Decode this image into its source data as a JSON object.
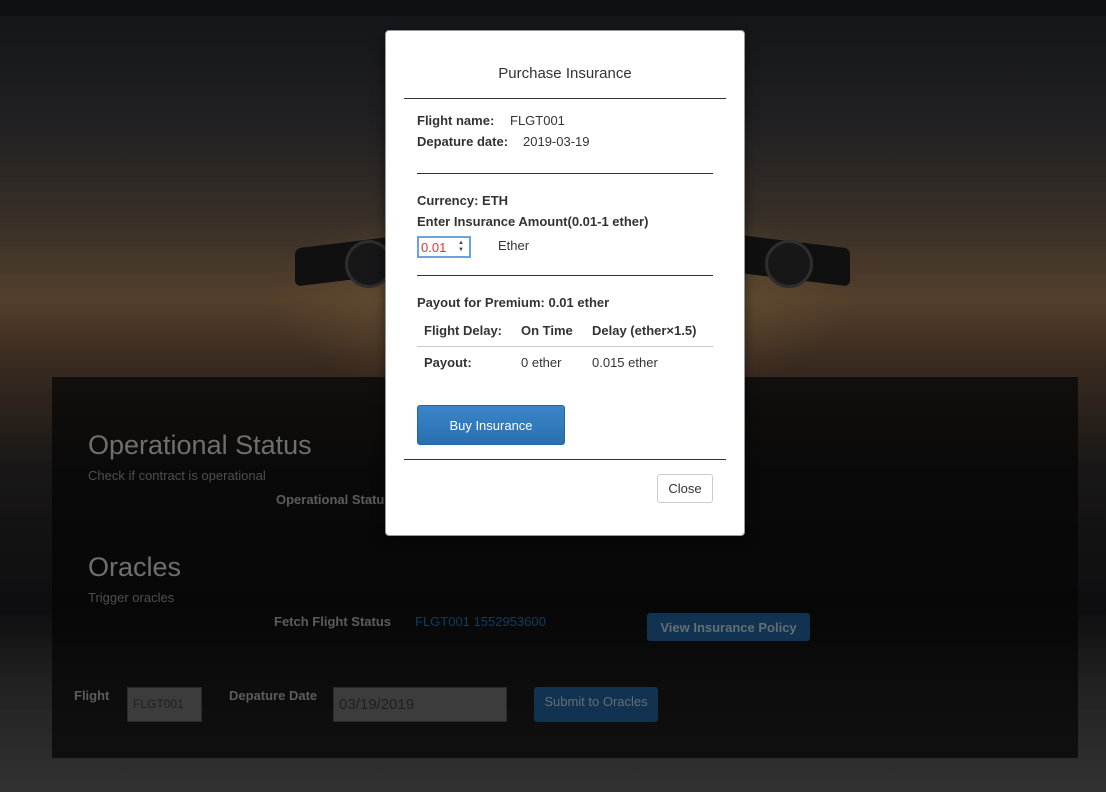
{
  "page": {
    "operational": {
      "title": "Operational Status",
      "subtitle": "Check if contract is operational",
      "status_label": "Operational Status"
    },
    "oracles": {
      "title": "Oracles",
      "subtitle": "Trigger oracles",
      "fetch_label": "Fetch Flight Status",
      "fetch_link": "FLGT001 1552953600",
      "view_policy_button": "View Insurance Policy",
      "flight_label": "Flight",
      "flight_value": "FLGT001",
      "date_label": "Depature Date",
      "date_value": "03/19/2019",
      "submit_button": "Submit to Oracles"
    }
  },
  "modal": {
    "title": "Purchase Insurance",
    "flight_name_label": "Flight name:",
    "flight_name_value": "FLGT001",
    "departure_label": "Depature date:",
    "departure_value": "2019-03-19",
    "currency_label": "Currency: ETH",
    "amount_label": "Enter Insurance Amount(0.01-1 ether)",
    "amount_value": "0.01",
    "amount_unit": "Ether",
    "payout_title": "Payout for Premium: 0.01 ether",
    "table": {
      "headers": [
        "Flight Delay:",
        "On Time",
        "Delay (ether×1.5)"
      ],
      "row": [
        "Payout:",
        "0 ether",
        "0.015 ether"
      ]
    },
    "buy_button": "Buy Insurance",
    "close_button": "Close"
  },
  "colors": {
    "accent": "#2a6fb0",
    "input_text": "#e4332f"
  }
}
